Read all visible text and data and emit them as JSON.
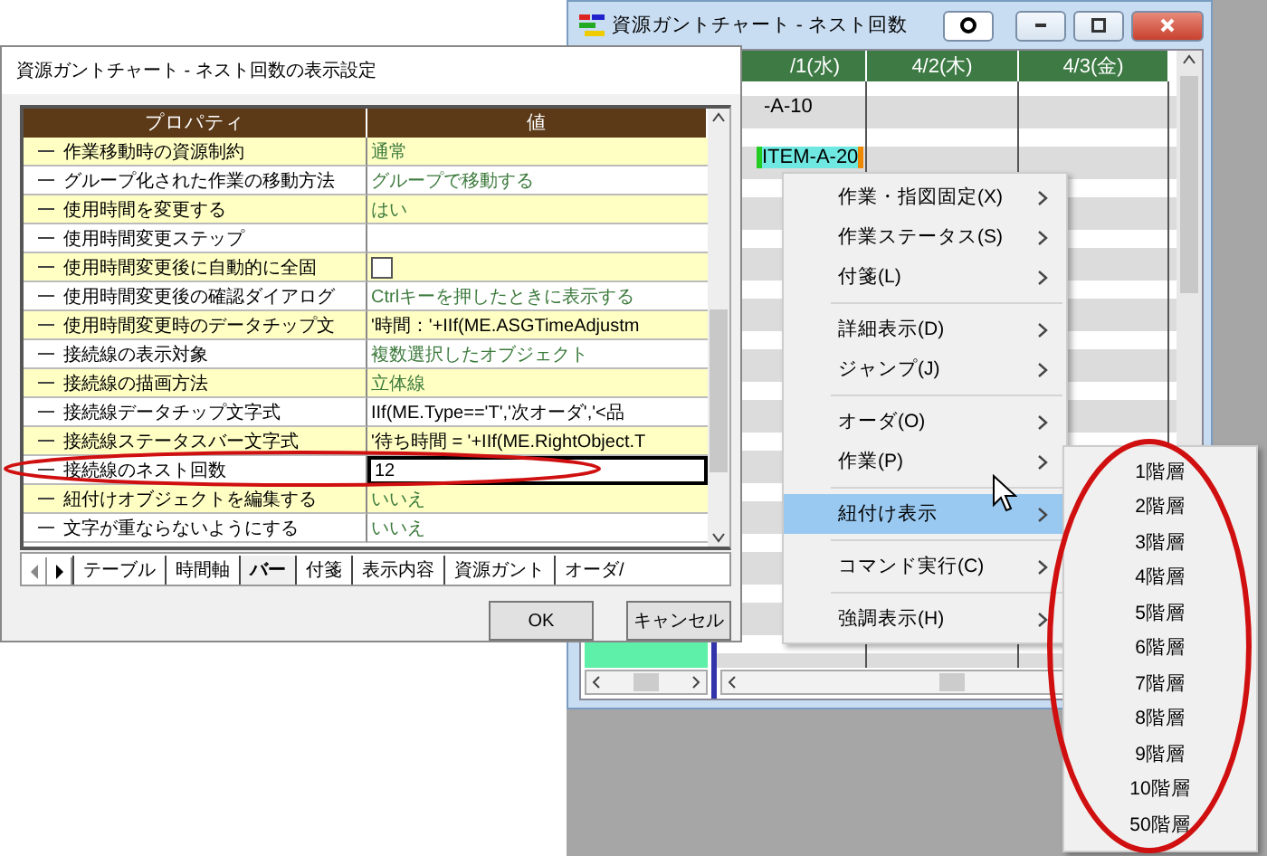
{
  "dialog": {
    "title": "資源ガントチャート - ネスト回数の表示設定",
    "columns": [
      "プロパティ",
      "値"
    ],
    "rows": [
      {
        "name": "作業移動時の資源制約",
        "value": "通常",
        "kind": "option",
        "selected": false
      },
      {
        "name": "グループ化された作業の移動方法",
        "value": "グループで移動する",
        "kind": "option",
        "selected": false
      },
      {
        "name": "使用時間を変更する",
        "value": "はい",
        "kind": "option",
        "selected": false
      },
      {
        "name": "使用時間変更ステップ",
        "kind": "empty"
      },
      {
        "name": "使用時間変更後に自動的に全固",
        "kind": "checkbox",
        "checked": false,
        "selected": false
      },
      {
        "name": "使用時間変更後の確認ダイアログ",
        "value": "Ctrlキーを押したときに表示する",
        "kind": "option",
        "selected": false
      },
      {
        "name": "使用時間変更時のデータチップ文",
        "value": "'時間：'+IIf(ME.ASGTimeAdjustm",
        "kind": "formula",
        "selected": false
      },
      {
        "name": "接続線の表示対象",
        "value": "複数選択したオブジェクト",
        "kind": "option",
        "selected": false
      },
      {
        "name": "接続線の描画方法",
        "value": "立体線",
        "kind": "option",
        "selected": false
      },
      {
        "name": "接続線データチップ文字式",
        "value": "IIf(ME.Type=='T','次オーダ','<品",
        "kind": "formula",
        "selected": false
      },
      {
        "name": "接続線ステータスバー文字式",
        "value": "'待ち時間 = '+IIf(ME.RightObject.T",
        "kind": "formula",
        "selected": false
      },
      {
        "name": "接続線のネスト回数",
        "value": "12",
        "kind": "formula",
        "selected": true
      },
      {
        "name": "紐付けオブジェクトを編集する",
        "value": "いいえ",
        "kind": "option",
        "selected": false
      },
      {
        "name": "文字が重ならないようにする",
        "value": "いいえ",
        "kind": "option",
        "selected": false
      }
    ],
    "tabs": [
      {
        "label": "テーブル",
        "selected": false
      },
      {
        "label": "時間軸",
        "selected": false
      },
      {
        "label": "バー",
        "selected": true
      },
      {
        "label": "付箋",
        "selected": false
      },
      {
        "label": "表示内容",
        "selected": false
      },
      {
        "label": "資源ガント",
        "selected": false
      },
      {
        "label": "オーダ/",
        "selected": false
      }
    ],
    "buttons": [
      "OK",
      "キャンセル"
    ]
  },
  "gantt": {
    "title": "資源ガントチャート - ネスト回数",
    "columns": [
      "/1(水)",
      "4/2(木)",
      "4/3(金)"
    ],
    "rows": [
      {
        "label": "-A-10",
        "selected": false
      },
      {
        "label": "ITEM-A-20",
        "selected": true
      }
    ]
  },
  "context_menu": {
    "groups": [
      [
        {
          "label": "作業・指図固定(X)",
          "selected": false
        },
        {
          "label": "作業ステータス(S)",
          "selected": false
        },
        {
          "label": "付箋(L)",
          "selected": false
        }
      ],
      [
        {
          "label": "詳細表示(D)",
          "selected": false
        },
        {
          "label": "ジャンプ(J)",
          "selected": false
        }
      ],
      [
        {
          "label": "オーダ(O)",
          "selected": false
        },
        {
          "label": "作業(P)",
          "selected": false
        }
      ],
      [
        {
          "label": "紐付け表示",
          "selected": true
        }
      ],
      [
        {
          "label": "コマンド実行(C)",
          "selected": false
        }
      ],
      [
        {
          "label": "強調表示(H)",
          "selected": false
        }
      ]
    ],
    "submenu": [
      "1階層",
      "2階層",
      "3階層",
      "4階層",
      "5階層",
      "6階層",
      "7階層",
      "8階層",
      "9階層",
      "10階層",
      "50階層"
    ]
  }
}
